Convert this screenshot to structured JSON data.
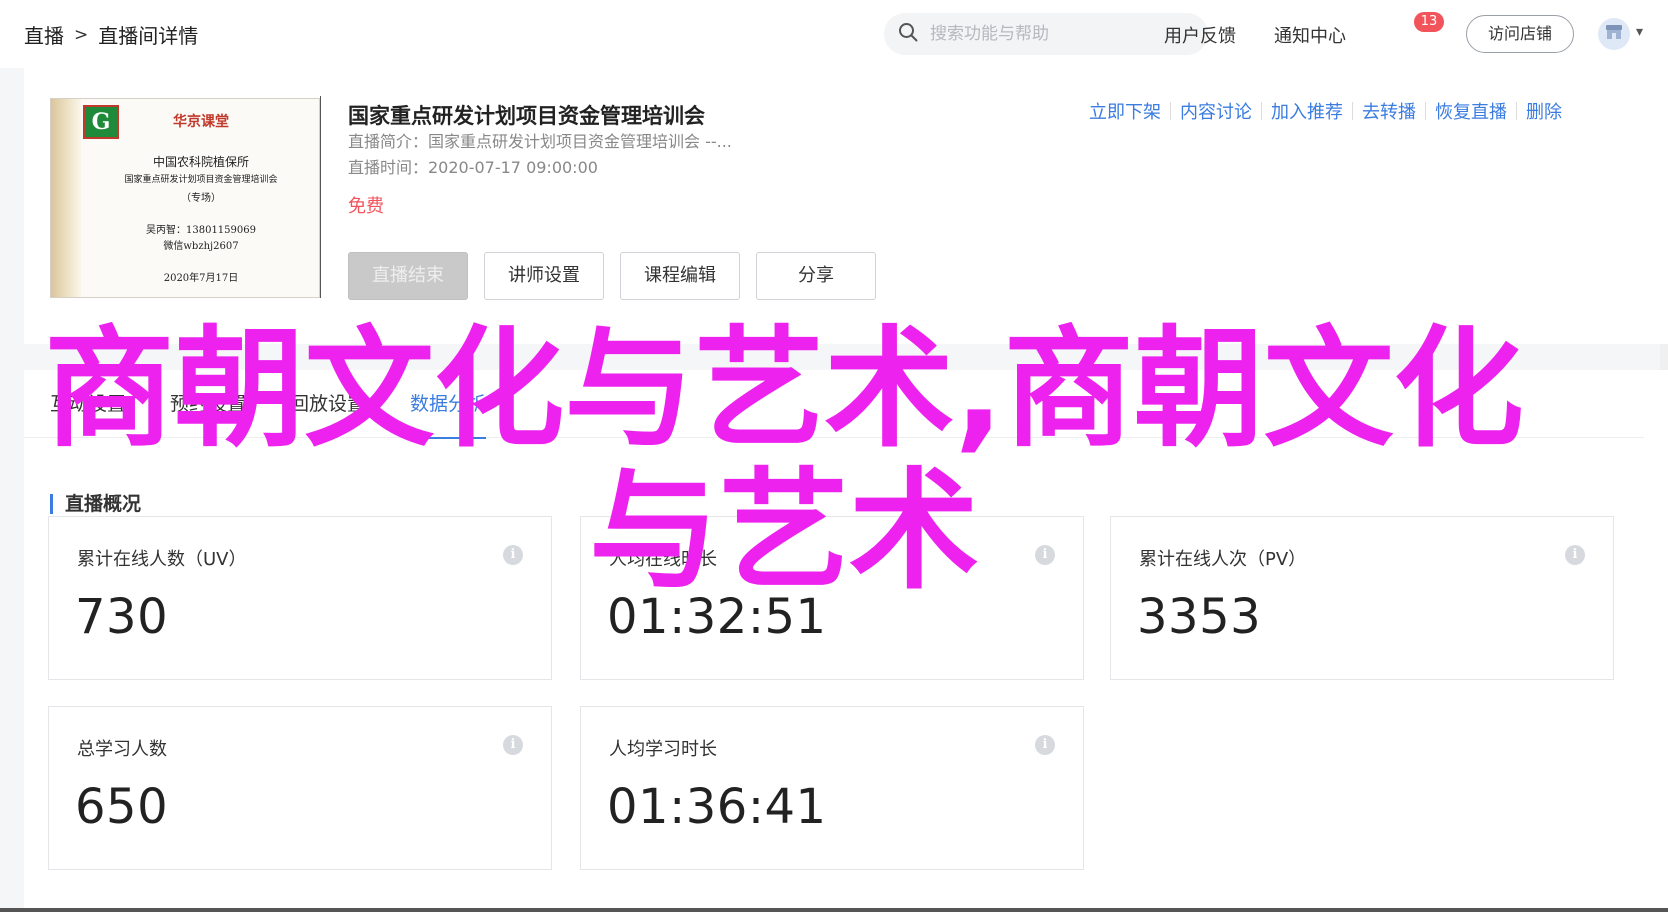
{
  "header": {
    "breadcrumb": [
      "直播",
      "直播间详情"
    ],
    "breadcrumb_sep": ">",
    "search_placeholder": "搜索功能与帮助",
    "feedback_label": "用户反馈",
    "notification_label": "通知中心",
    "notification_count": "13",
    "visit_store_label": "访问店铺"
  },
  "course": {
    "cover": {
      "brand": "华京课堂",
      "org": "中国农科院植保所",
      "program": "国家重点研发计划项目资金管理培训会",
      "tag": "（专场）",
      "contact": "吴丙智：13801159069",
      "wechat": "微信wbzhj2607",
      "date": "2020年7月17日",
      "logo_letter": "G"
    },
    "title": "国家重点研发计划项目资金管理培训会",
    "intro": "直播简介：国家重点研发计划项目资金管理培训会 --...",
    "time": "直播时间：2020-07-17 09:00:00",
    "price": "免费",
    "actions": [
      "立即下架",
      "内容讨论",
      "加入推荐",
      "去转播",
      "恢复直播",
      "删除"
    ],
    "buttons": {
      "end_live": "直播结束",
      "teacher_settings": "讲师设置",
      "course_edit": "课程编辑",
      "share": "分享"
    }
  },
  "tabs": [
    "互动设置",
    "预约设置",
    "回放设置",
    "数据分析"
  ],
  "active_tab": "数据分析",
  "overview": {
    "title": "直播概况",
    "stats": [
      {
        "label": "累计在线人数（UV）",
        "value": "730"
      },
      {
        "label": "人均在线时长",
        "value": "01:32:51"
      },
      {
        "label": "累计在线人次（PV）",
        "value": "3353"
      },
      {
        "label": "总学习人数",
        "value": "650"
      },
      {
        "label": "人均学习时长",
        "value": "01:36:41"
      }
    ]
  },
  "overlay_text": "商朝文化与艺术,商朝文化与艺术",
  "colors": {
    "accent": "#3a7ce0",
    "badge": "#f2545b",
    "price": "#f2545b",
    "overlay": "#ee22ee"
  }
}
